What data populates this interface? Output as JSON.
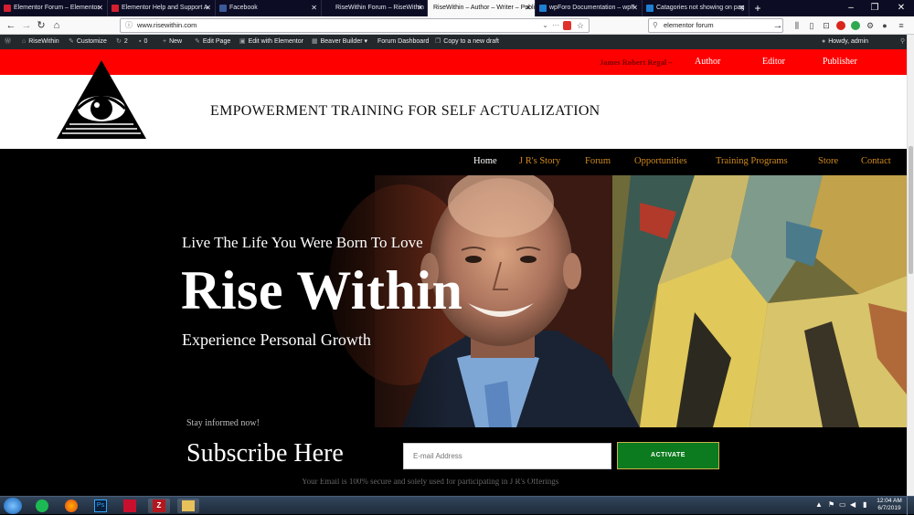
{
  "browser": {
    "tabs": [
      {
        "label": "Elementor Forum – Elementor",
        "favicon_color": "#d31f2e"
      },
      {
        "label": "Elementor Help and Support A",
        "favicon_color": "#d31f2e"
      },
      {
        "label": "Facebook",
        "favicon_color": "#3b5998"
      },
      {
        "label": "RiseWithin Forum – RiseWithin",
        "favicon_color": "#2b5797"
      },
      {
        "label": "RiseWithin – Author – Writer – Publi",
        "favicon_color": "#888888"
      },
      {
        "label": "wpForo Documentation – wpF",
        "favicon_color": "#1f7fd1"
      },
      {
        "label": "Catagories not showing on pag",
        "favicon_color": "#1f7fd1"
      }
    ],
    "new_tab": "+",
    "url": "www.risewithin.com",
    "search_value": "elementor forum",
    "window_controls": [
      "–",
      "❐",
      "✕"
    ]
  },
  "wp_admin": {
    "site_name": "RiseWithin",
    "customize": "Customize",
    "updates_count": "2",
    "comments_count": "0",
    "new": "New",
    "edit_page": "Edit Page",
    "edit_elementor": "Edit with Elementor",
    "beaver_builder": "Beaver Builder ▾",
    "forum_dashboard": "Forum Dashboard",
    "copy_draft": "Copy to a new draft",
    "howdy": "Howdy, admin"
  },
  "site": {
    "top_links": {
      "name": "James Robert Regal –",
      "author": "Author",
      "editor": "Editor",
      "publisher": "Publisher"
    },
    "tagline": "EMPOWERMENT TRAINING FOR SELF ACTUALIZATION",
    "nav": [
      "Home",
      "J R's Story",
      "Forum",
      "Opportunities",
      "Training Programs",
      "Store",
      "Contact"
    ],
    "hero": {
      "kicker": "Live The Life You Were Born To Love",
      "title": "Rise Within",
      "subtitle": "Experience Personal Growth"
    },
    "subscribe": {
      "stay_informed": "Stay informed now!",
      "title": "Subscribe Here",
      "email_placeholder": "E-mail Address",
      "button": "ACTIVATE",
      "note": "Your Email is 100% secure and solely used for participating in J R's Offerings"
    },
    "colors": {
      "accent_red": "#ff0000",
      "nav_gold": "#d08a1e",
      "button_green": "#0c7a1e"
    }
  },
  "taskbar": {
    "time": "12:04 AM",
    "date": "6/7/2019",
    "apps": [
      "start-orb",
      "spotify",
      "firefox",
      "photoshop",
      "acrobat",
      "filezilla",
      "file-explorer"
    ]
  }
}
